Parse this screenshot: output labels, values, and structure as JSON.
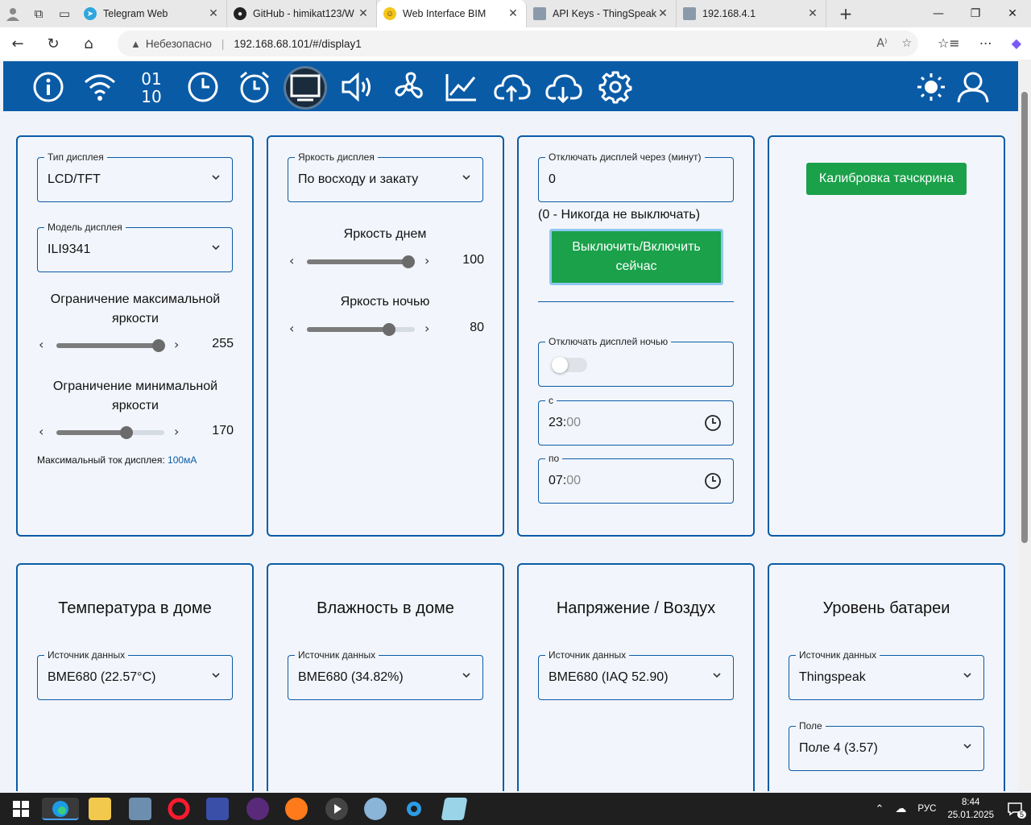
{
  "browser": {
    "tabs": [
      {
        "title": "Telegram Web",
        "color": "#2ea6de",
        "glyph": "➤"
      },
      {
        "title": "GitHub - himikat123/W",
        "color": "#222222",
        "glyph": "●"
      },
      {
        "title": "Web Interface BIM",
        "color": "#f5c518",
        "glyph": "☺"
      },
      {
        "title": "API Keys - ThingSpeak I",
        "color": "#6a7a8a",
        "glyph": "□"
      },
      {
        "title": "192.168.4.1",
        "color": "#6a7a8a",
        "glyph": "□"
      }
    ],
    "security_label": "Небезопасно",
    "url": "192.168.68.101/#/display1"
  },
  "nav": {
    "icons": [
      "info-icon",
      "wifi-icon",
      "binary-icon",
      "clock-icon",
      "alarm-icon",
      "display-icon",
      "speaker-icon",
      "fan-icon",
      "chart-icon",
      "upload-icon",
      "download-icon",
      "gear-icon"
    ],
    "right_icons": [
      "sun-icon",
      "user-icon"
    ]
  },
  "card1": {
    "display_type_label": "Тип дисплея",
    "display_type_value": "LCD/TFT",
    "display_model_label": "Модель дисплея",
    "display_model_value": "ILI9341",
    "max_brightness_title": "Ограничение максимальной яркости",
    "max_brightness_value": 255,
    "max_brightness_fraction": 0.95,
    "min_brightness_title": "Ограничение минимальной яркости",
    "min_brightness_value": 170,
    "min_brightness_fraction": 0.65,
    "max_current_label": "Максимальный ток дисплея:",
    "max_current_value": "100мА"
  },
  "card2": {
    "brightness_label": "Яркость дисплея",
    "brightness_value": "По восходу и закату",
    "day_title": "Яркость днем",
    "day_value": 100,
    "day_fraction": 0.94,
    "night_title": "Яркость ночью",
    "night_value": 80,
    "night_fraction": 0.76
  },
  "card3": {
    "off_after_label": "Отключать дисплей через (минут)",
    "off_after_value": "0",
    "off_hint": "(0 - Никогда не выключать)",
    "toggle_button": "Выключить/Включить сейчас",
    "night_off_label": "Отключать дисплей ночью",
    "night_off_enabled": false,
    "from_label": "с",
    "from_hours": "23:",
    "from_minutes": "00",
    "to_label": "по",
    "to_hours": "07:",
    "to_minutes": "00"
  },
  "card4": {
    "calibrate_button": "Калибровка тачскрина"
  },
  "sensors": [
    {
      "title": "Температура в доме",
      "source_label": "Источник данных",
      "source_value": "BME680 (22.57°C)"
    },
    {
      "title": "Влажность в доме",
      "source_label": "Источник данных",
      "source_value": "BME680 (34.82%)"
    },
    {
      "title": "Напряжение / Воздух",
      "source_label": "Источник данных",
      "source_value": "BME680 (IAQ 52.90)"
    },
    {
      "title": "Уровень батареи",
      "source_label": "Источник данных",
      "source_value": "Thingspeak",
      "field_label": "Поле",
      "field_value": "Поле 4 (3.57)"
    }
  ],
  "taskbar": {
    "lang": "РУС",
    "time": "8:44",
    "date": "25.01.2025",
    "notifications": "5"
  }
}
